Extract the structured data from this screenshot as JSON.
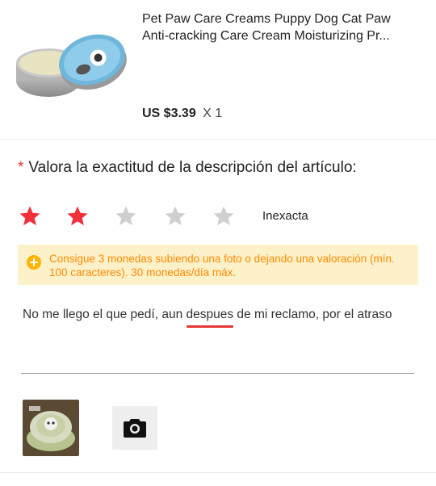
{
  "product": {
    "title_line1": "Pet Paw Care Creams Puppy Dog Cat Paw",
    "title_line2": "Anti-cracking Care Cream Moisturizing Pr...",
    "price": "US $3.39",
    "quantity": "X 1",
    "image_icon": "product-tin-image"
  },
  "rating": {
    "required_mark": "*",
    "question": "Valora la exactitud de la descripción del artículo:",
    "value": 2,
    "max": 5,
    "label": "Inexacta",
    "active_color": "#f0303a",
    "inactive_color": "#cfcfcf"
  },
  "notice": {
    "text": "Consigue 3 monedas subiendo una foto o dejando una valoración (mín. 100 caracteres). 30 monedas/día máx.",
    "color": "#ff8a00",
    "background": "#fdf1c9"
  },
  "review": {
    "text_before": "No me llego el que pedí, aun ",
    "misspelled": "despues",
    "text_after": " de mi reclamo, por el atraso"
  },
  "photos": {
    "thumbnail_icon": "uploaded-photo-thumbnail",
    "add_icon": "camera-icon"
  }
}
